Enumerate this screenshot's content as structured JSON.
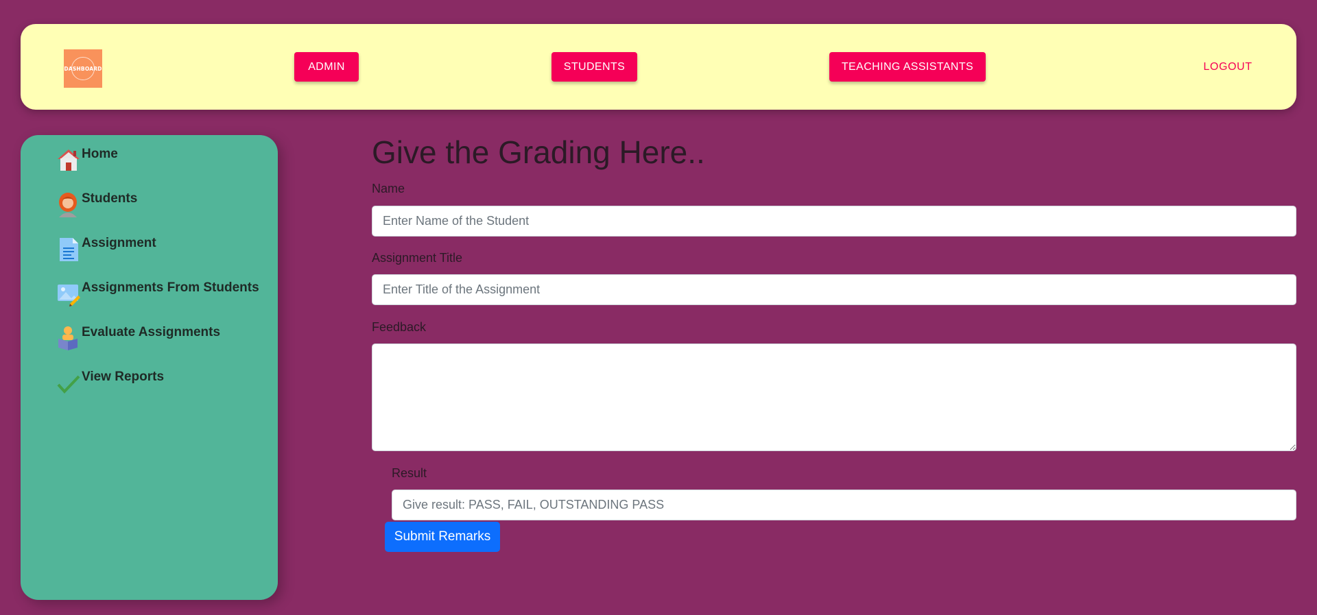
{
  "header": {
    "logo_text": "DASHBOARD",
    "nav": [
      {
        "label": "ADMIN"
      },
      {
        "label": "STUDENTS"
      },
      {
        "label": "TEACHING ASSISTANTS"
      }
    ],
    "logout_label": "LOGOUT"
  },
  "sidebar": {
    "items": [
      {
        "label": "Home",
        "icon": "house-icon"
      },
      {
        "label": "Students",
        "icon": "student-icon"
      },
      {
        "label": "Assignment",
        "icon": "document-icon"
      },
      {
        "label": "Assignments From Students",
        "icon": "image-edit-icon"
      },
      {
        "label": "Evaluate Assignments",
        "icon": "reader-icon"
      },
      {
        "label": "View Reports",
        "icon": "checkmark-icon"
      }
    ]
  },
  "form": {
    "title": "Give the Grading Here..",
    "name_label": "Name",
    "name_placeholder": "Enter Name of the Student",
    "name_value": "",
    "assignment_label": "Assignment Title",
    "assignment_placeholder": "Enter Title of the Assignment",
    "assignment_value": "",
    "feedback_label": "Feedback",
    "feedback_value": "",
    "result_label": "Result",
    "result_placeholder": "Give result: PASS, FAIL, OUTSTANDING PASS",
    "result_value": "",
    "submit_label": "Submit Remarks"
  },
  "colors": {
    "background": "#892b64",
    "topbar": "#ffffb5",
    "sidebar": "#52b599",
    "nav_button": "#f50057",
    "submit_button": "#0d6efd",
    "logo": "#f9925b"
  }
}
